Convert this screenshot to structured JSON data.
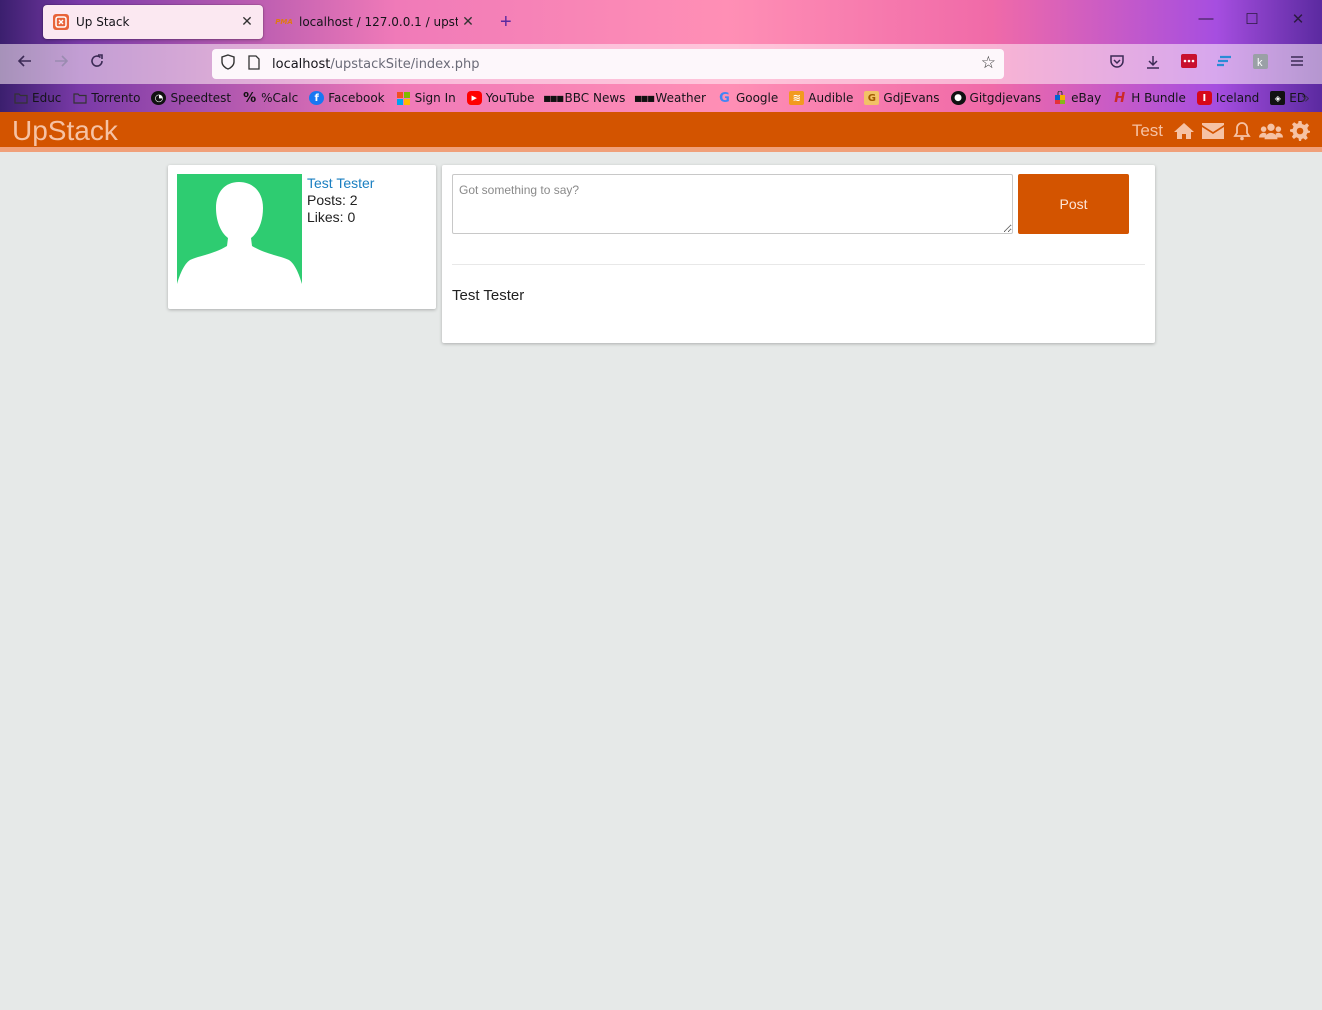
{
  "browser": {
    "tabs": [
      {
        "title": "Up Stack",
        "active": true,
        "favicon": "upstack-favicon"
      },
      {
        "title": "localhost / 127.0.0.1 / upstack /",
        "active": false,
        "favicon": "phpmyadmin-favicon"
      }
    ],
    "url": {
      "host": "localhost",
      "path": "/upstackSite/index.php"
    },
    "bookmarks": [
      {
        "label": "Educ",
        "icon": "folder-icon"
      },
      {
        "label": "Torrento",
        "icon": "folder-icon"
      },
      {
        "label": "Speedtest",
        "icon": "speedtest-icon"
      },
      {
        "label": "%Calc",
        "icon": "percent-icon"
      },
      {
        "label": "Facebook",
        "icon": "facebook-icon"
      },
      {
        "label": "Sign In",
        "icon": "microsoft-icon"
      },
      {
        "label": "YouTube",
        "icon": "youtube-icon"
      },
      {
        "label": "BBC News",
        "icon": "bbc-icon"
      },
      {
        "label": "Weather",
        "icon": "bbc-icon"
      },
      {
        "label": "Google",
        "icon": "google-icon"
      },
      {
        "label": "Audible",
        "icon": "audible-icon"
      },
      {
        "label": "GdjEvans",
        "icon": "g-icon"
      },
      {
        "label": "Gitgdjevans",
        "icon": "github-icon"
      },
      {
        "label": "eBay",
        "icon": "ebay-icon"
      },
      {
        "label": "H Bundle",
        "icon": "humble-icon"
      },
      {
        "label": "Iceland",
        "icon": "iceland-icon"
      },
      {
        "label": "ED",
        "icon": "ed-icon"
      }
    ]
  },
  "site": {
    "logo": "UpStack",
    "header_user": "Test",
    "accent_color": "#d35400",
    "avatar_color": "#2ecc71"
  },
  "profile": {
    "name": "Test Tester",
    "posts": "Posts: 2",
    "likes": "Likes: 0"
  },
  "composer": {
    "placeholder": "Got something to say?",
    "post_label": "Post"
  },
  "feed": {
    "posts": [
      {
        "author": "Test Tester"
      }
    ]
  }
}
